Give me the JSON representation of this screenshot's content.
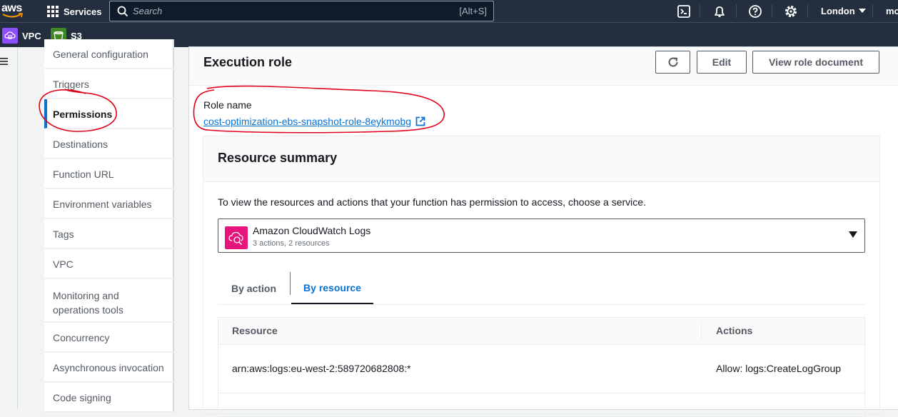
{
  "topbar": {
    "logo_text": "aws",
    "services_label": "Services",
    "search_placeholder": "Search",
    "search_shortcut": "[Alt+S]",
    "region": "London",
    "account": "mo",
    "icons": [
      "cloudshell-icon",
      "bell-icon",
      "help-icon",
      "gear-icon"
    ]
  },
  "favorites": [
    {
      "label": "VPC",
      "color": "#8c4fff",
      "icon": "vpc-icon"
    },
    {
      "label": "S3",
      "color": "#3f8624",
      "icon": "s3-bucket-icon"
    }
  ],
  "section_nav": {
    "items": [
      {
        "label": "General configuration"
      },
      {
        "label": "Triggers"
      },
      {
        "label": "Permissions",
        "active": true
      },
      {
        "label": "Destinations"
      },
      {
        "label": "Function URL"
      },
      {
        "label": "Environment variables"
      },
      {
        "label": "Tags"
      },
      {
        "label": "VPC"
      },
      {
        "label": "Monitoring and operations tools"
      },
      {
        "label": "Concurrency"
      },
      {
        "label": "Asynchronous invocation"
      },
      {
        "label": "Code signing"
      }
    ]
  },
  "execution_role": {
    "title": "Execution role",
    "refresh_icon": "refresh-icon",
    "edit_label": "Edit",
    "view_doc_label": "View role document",
    "role_name_label": "Role name",
    "role_name": "cost-optimization-ebs-snapshot-role-8eykmobg"
  },
  "resource_summary": {
    "title": "Resource summary",
    "description": "To view the resources and actions that your function has permission to access, choose a service.",
    "service": {
      "name": "Amazon CloudWatch Logs",
      "detail": "3 actions, 2 resources",
      "icon": "cloudwatch-logs-icon"
    },
    "tabs": [
      {
        "label": "By action"
      },
      {
        "label": "By resource",
        "active": true
      }
    ],
    "table": {
      "headers": [
        "Resource",
        "Actions"
      ],
      "rows": [
        [
          "arn:aws:logs:eu-west-2:589720682808:*",
          "Allow: logs:CreateLogGroup"
        ]
      ]
    }
  },
  "colors": {
    "nav_bg": "#232f3e",
    "link": "#0972d3",
    "annotation": "#e0001a",
    "service_icon": "#e7157b"
  }
}
